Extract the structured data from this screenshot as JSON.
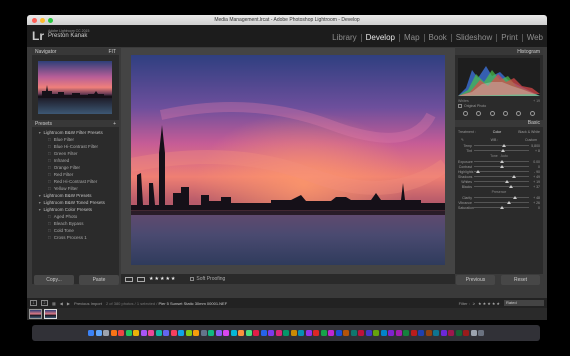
{
  "window": {
    "title": "Media Management.lrcat - Adobe Photoshop Lightroom - Develop"
  },
  "identity": {
    "logo": "Lr",
    "product": "Adobe Lightroom CC 2015",
    "user": "Preston Kanak"
  },
  "modules": [
    {
      "label": "Library",
      "active": false
    },
    {
      "label": "Develop",
      "active": true
    },
    {
      "label": "Map",
      "active": false
    },
    {
      "label": "Book",
      "active": false
    },
    {
      "label": "Slideshow",
      "active": false
    },
    {
      "label": "Print",
      "active": false
    },
    {
      "label": "Web",
      "active": false
    }
  ],
  "left_panel": {
    "navigator_title": "Navigator",
    "navigator_zoom": "FIT",
    "presets_title": "Presets",
    "presets": [
      {
        "label": "Lightroom B&W Filter Presets",
        "kind": "group"
      },
      {
        "label": "Blue Filter",
        "kind": "child"
      },
      {
        "label": "Blue Hi-Contrast Filter",
        "kind": "child"
      },
      {
        "label": "Green Filter",
        "kind": "child"
      },
      {
        "label": "Infrared",
        "kind": "child"
      },
      {
        "label": "Orange Filter",
        "kind": "child"
      },
      {
        "label": "Red Filter",
        "kind": "child"
      },
      {
        "label": "Red Hi-Contrast Filter",
        "kind": "child"
      },
      {
        "label": "Yellow Filter",
        "kind": "child"
      },
      {
        "label": "Lightroom B&W Presets",
        "kind": "group"
      },
      {
        "label": "Lightroom B&W Toned Presets",
        "kind": "group"
      },
      {
        "label": "Lightroom Color Presets",
        "kind": "group"
      },
      {
        "label": "Aged Photo",
        "kind": "child"
      },
      {
        "label": "Bleach Bypass",
        "kind": "child"
      },
      {
        "label": "Cold Tone",
        "kind": "child"
      },
      {
        "label": "Cross Process 1",
        "kind": "child"
      }
    ],
    "copy_label": "Copy...",
    "paste_label": "Paste"
  },
  "toolbar": {
    "stars": "★★★★★",
    "soft_proofing": "Soft Proofing"
  },
  "right_panel": {
    "histogram_title": "Histogram",
    "whites_label": "Whites",
    "whites_value": "+ 19",
    "original_photo": "Original Photo",
    "basic_title": "Basic",
    "treatment_label": "Treatment :",
    "treatment_color": "Color",
    "treatment_bw": "Black & White",
    "wb_label": "WB :",
    "wb_value": "Custom",
    "tone_label": "Tone",
    "tone_auto": "Auto",
    "presence_label": "Presence",
    "sliders_top": [
      {
        "label": "Temp",
        "value": "5,800",
        "pos": 0.55
      },
      {
        "label": "Tint",
        "value": "+ 8",
        "pos": 0.52
      }
    ],
    "sliders_tone": [
      {
        "label": "Exposure",
        "value": "0.00",
        "pos": 0.5
      },
      {
        "label": "Contrast",
        "value": "0",
        "pos": 0.5
      },
      {
        "label": "Highlights",
        "value": "- 90",
        "pos": 0.08
      },
      {
        "label": "Shadows",
        "value": "+ 49",
        "pos": 0.73
      },
      {
        "label": "Whites",
        "value": "+ 19",
        "pos": 0.6
      },
      {
        "label": "Blacks",
        "value": "+ 37",
        "pos": 0.68
      }
    ],
    "sliders_presence": [
      {
        "label": "Clarity",
        "value": "+ 48",
        "pos": 0.74
      },
      {
        "label": "Vibrance",
        "value": "+ 26",
        "pos": 0.63
      },
      {
        "label": "Saturation",
        "value": "0",
        "pos": 0.5
      }
    ],
    "previous_label": "Previous",
    "reset_label": "Reset"
  },
  "filmstrip": {
    "monitor1": "1",
    "monitor2": "2",
    "source": "Previous Import",
    "count_text": "2 of 380 photos / 1 selected /",
    "file_name": "Pier 5 Sunset Static 30mm 00001.NEF",
    "filter_label": "Filter :",
    "filter_stars": "≥ ★★★★★",
    "filter_value": "Rated"
  },
  "colors": {
    "accent": "#e6e6e6",
    "panel_bg": "#2b2b2b",
    "app_bg": "#3a3a3a"
  }
}
